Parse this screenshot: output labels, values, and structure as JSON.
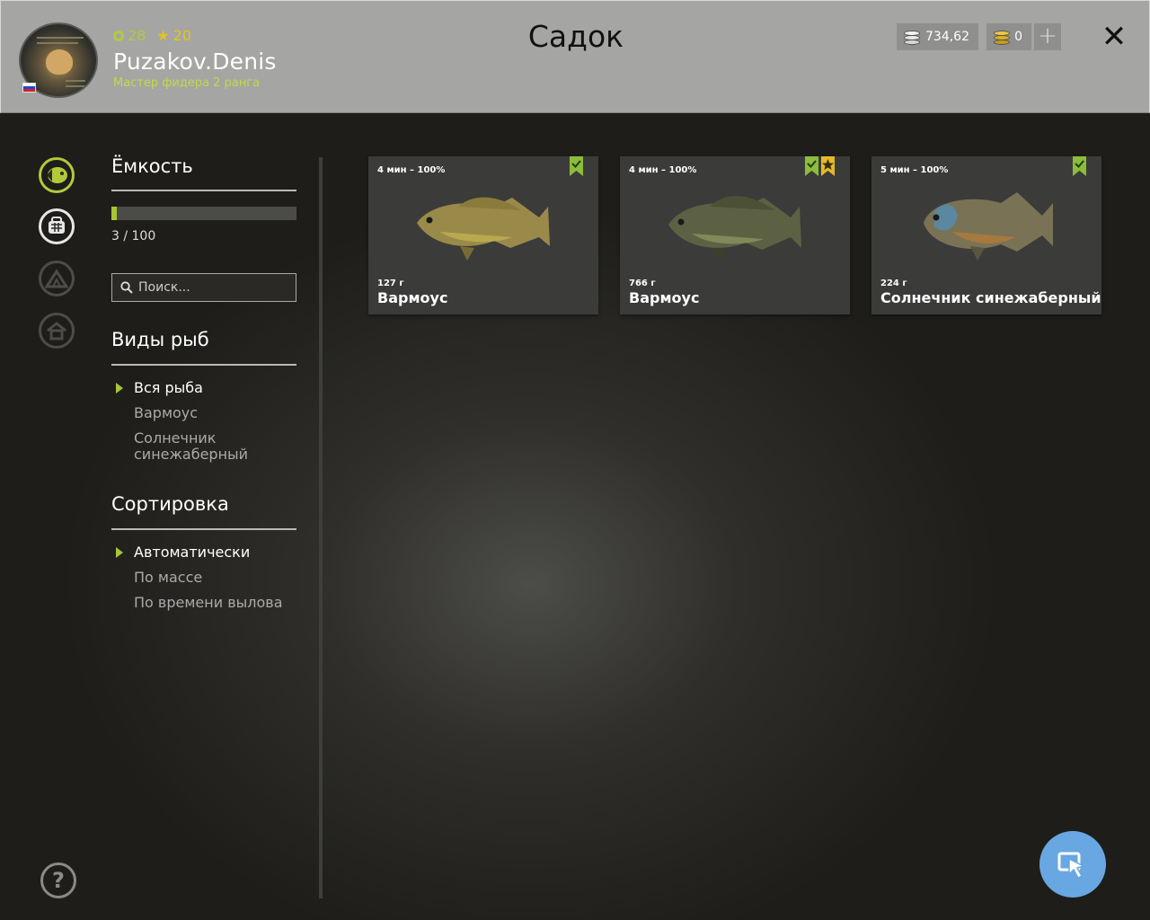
{
  "header": {
    "title": "Садок",
    "player": {
      "level": "28",
      "stars": "20",
      "name": "Puzakov.Denis",
      "rank": "Мастер фидера 2 ранга"
    },
    "silver": "734,62",
    "gold": "0",
    "add_icon": "plus-icon",
    "close_icon": "close-icon"
  },
  "rail": {
    "icons": [
      "fish-icon",
      "keepnet-icon",
      "tent-icon",
      "home-icon"
    ]
  },
  "capacity": {
    "title": "Ёмкость",
    "current": 3,
    "max": 100,
    "text": "3 / 100"
  },
  "search": {
    "placeholder": "Поиск..."
  },
  "species": {
    "title": "Виды рыб",
    "items": [
      "Вся рыба",
      "Вармоус",
      "Солнечник синежаберный"
    ],
    "selected": "Вся рыба"
  },
  "sort": {
    "title": "Сортировка",
    "items": [
      "Автоматически",
      "По массе",
      "По времени вылова"
    ],
    "selected": "Автоматически"
  },
  "fish": [
    {
      "time": "4 мин – 100%",
      "weight": "127 г",
      "name": "Вармоус",
      "badges": [
        "green"
      ]
    },
    {
      "time": "4 мин – 100%",
      "weight": "766 г",
      "name": "Вармоус",
      "badges": [
        "green",
        "yellow"
      ]
    },
    {
      "time": "5 мин – 100%",
      "weight": "224 г",
      "name": "Солнечник синежаберный",
      "badges": [
        "green"
      ]
    }
  ],
  "colors": {
    "accent_green": "#a9c536",
    "star_yellow": "#e4c320",
    "cursor_button": "#69a7e3"
  }
}
